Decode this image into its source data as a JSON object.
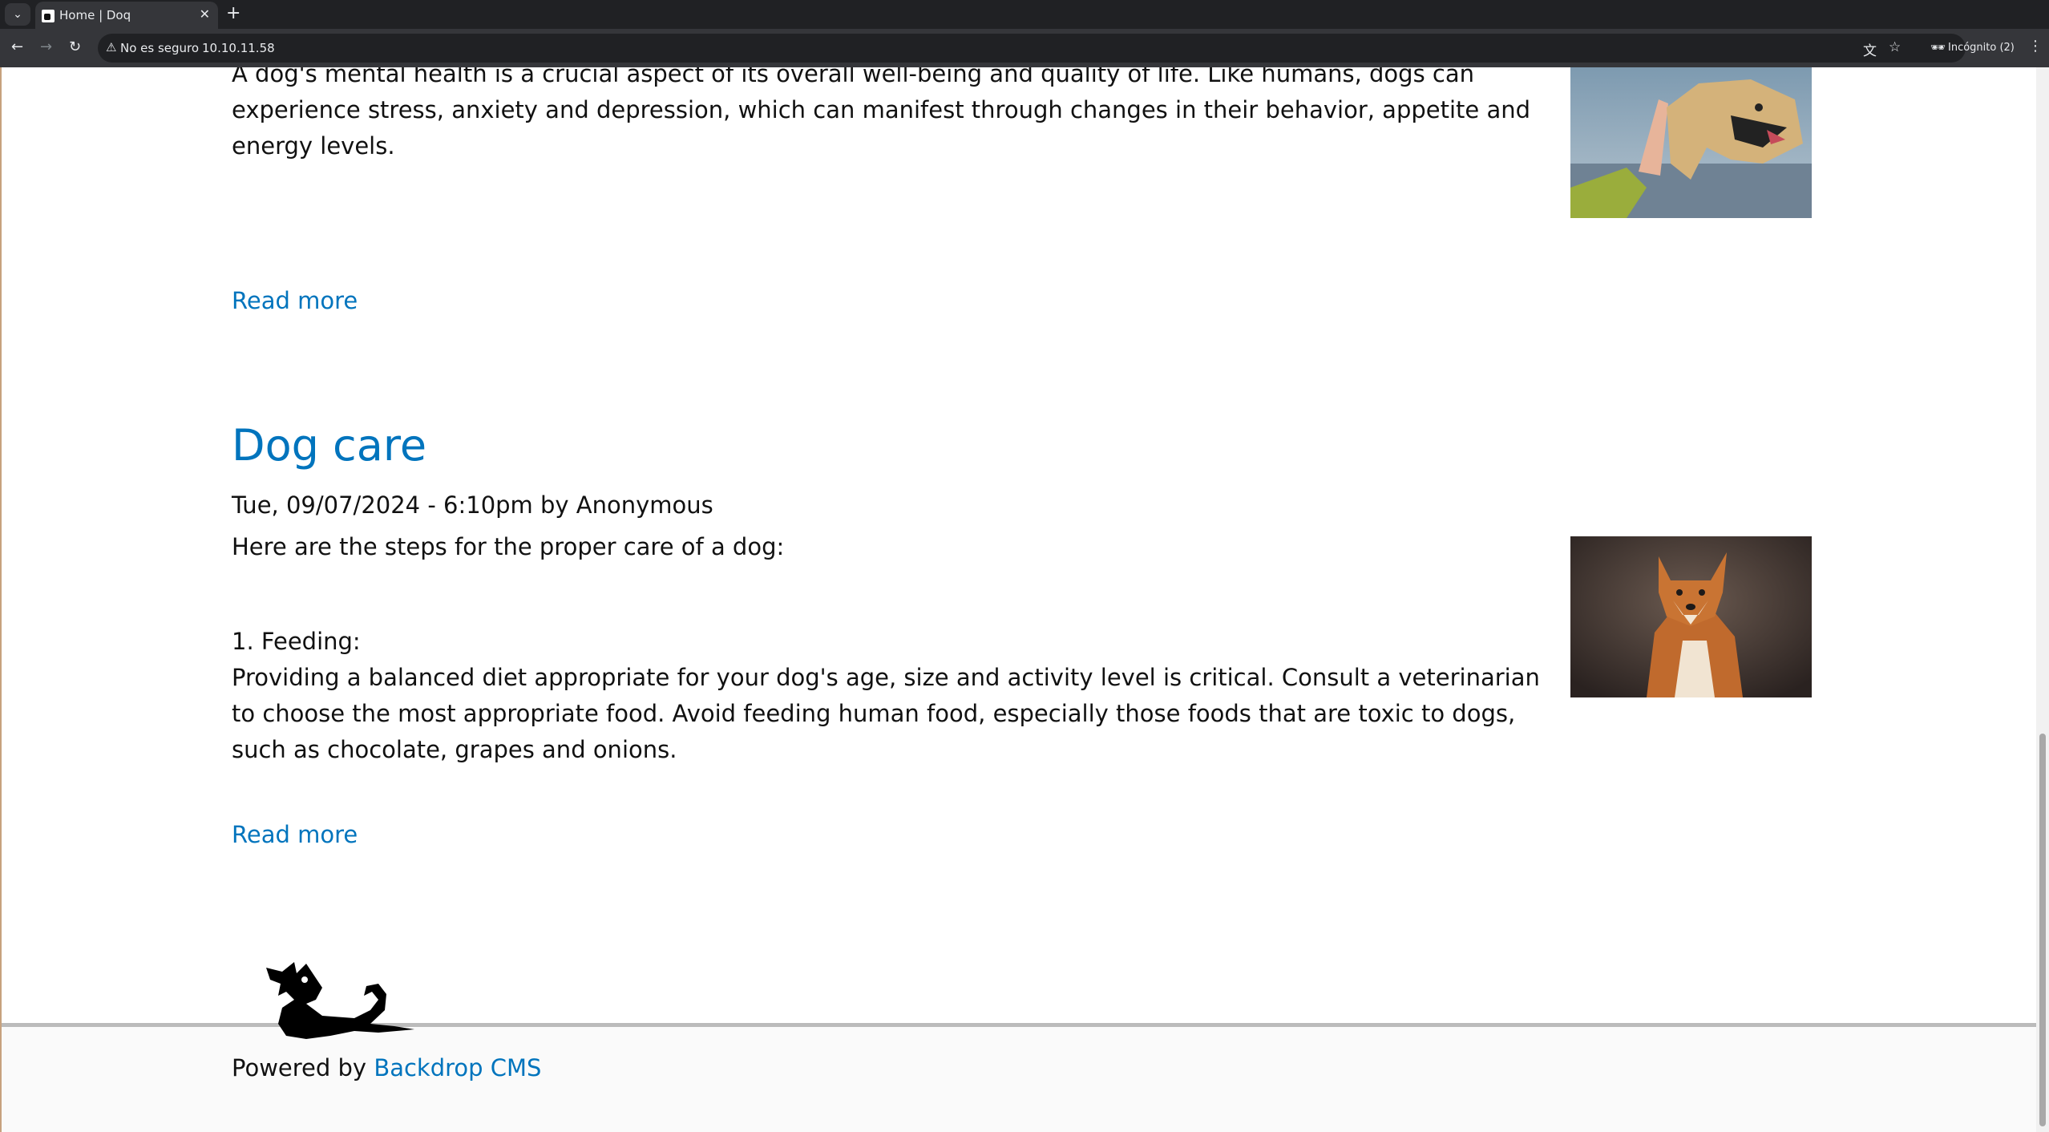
{
  "browser": {
    "tab_title": "Home | Doq",
    "new_tab_symbol": "+",
    "security_label": "No es seguro",
    "url": "10.10.11.58",
    "incognito_label": "Incógnito (2)"
  },
  "articles": [
    {
      "body": "A dog's mental health is a crucial aspect of its overall well-being and quality of life. Like humans, dogs can experience stress, anxiety and depression, which can manifest through changes in their behavior, appetite and energy levels.",
      "read_more": "Read more"
    },
    {
      "title": "Dog care",
      "meta": "Tue, 09/07/2024 - 6:10pm by Anonymous",
      "intro": "Here are the steps for the proper care of a dog:",
      "step_heading": "1. Feeding:",
      "step_body": "Providing a balanced diet appropriate for your dog's age, size and activity level is critical. Consult a veterinarian to choose the most appropriate food. Avoid feeding human food, especially those foods that are toxic to dogs, such as chocolate, grapes and onions.",
      "read_more": "Read more"
    }
  ],
  "footer": {
    "powered_prefix": "Powered by",
    "powered_link": "Backdrop CMS"
  },
  "colors": {
    "link": "#0074bd",
    "chrome_dark": "#202124",
    "chrome_toolbar": "#35363a"
  }
}
